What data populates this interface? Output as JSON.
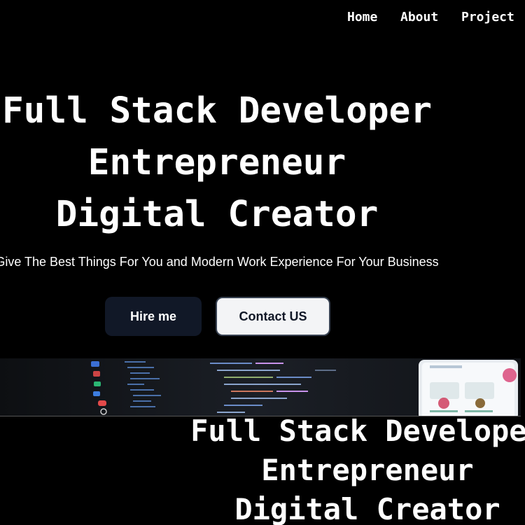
{
  "nav": {
    "items": [
      {
        "label": "Home"
      },
      {
        "label": "About"
      },
      {
        "label": "Project"
      }
    ]
  },
  "hero": {
    "lines": [
      "Full Stack Developer",
      "Entrepreneur",
      "Digital Creator"
    ],
    "tagline": "Give The Best Things For You and Modern Work Experience For Your Business"
  },
  "buttons": {
    "hire": "Hire me",
    "contact": "Contact US"
  },
  "hero_repeat": {
    "lines": [
      "Full Stack Developer",
      "Entrepreneur",
      "Digital Creator"
    ]
  },
  "colors": {
    "background": "#000000",
    "hire_bg": "#111827",
    "contact_bg": "#f3f4f6",
    "banner_bg": "#16191e"
  }
}
